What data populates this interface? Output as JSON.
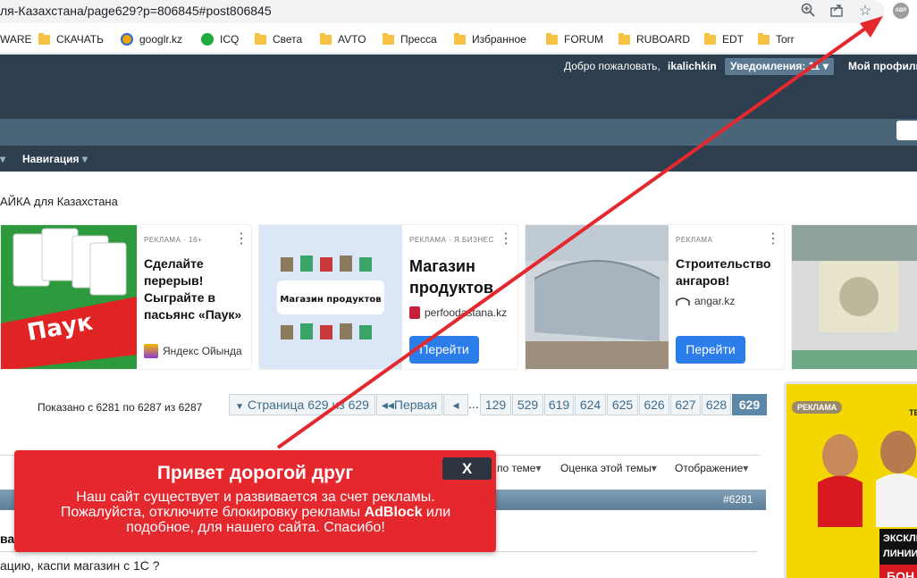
{
  "browser": {
    "url": "ля-Казахстана/page629?p=806845#post806845",
    "abp_label": "ABP",
    "bookmarks": [
      "WARE",
      "СКАЧАТЬ",
      "googlr.kz",
      "ICQ",
      "Света",
      "AVTO",
      "Пресса",
      "Избранное",
      "FORUM",
      "RUBOARD",
      "EDT",
      "Torr"
    ]
  },
  "header": {
    "welcome": "Добро пожаловать,",
    "username": "ikalichkin",
    "notifications": "Уведомления: 11",
    "profile": "Мой профиль"
  },
  "nav": {
    "navigation": "Навигация",
    "breadcrumb": "АЙКА для Казахстана"
  },
  "ads": [
    {
      "label": "РЕКЛАМА · 16+",
      "title": "Сделайте перерыв! Сыграйте в пасьянс «Паук»",
      "source": "Яндекс Ойында",
      "image_text": "Паук"
    },
    {
      "label": "РЕКЛАМА · Я.БИЗНЕС",
      "title": "Магазин продуктов",
      "source": "perfoodastana.kz",
      "image_text": "Магазин продуктов",
      "button": "Перейти"
    },
    {
      "label": "РЕКЛАМА",
      "title": "Строительство ангаров!",
      "source": "angar.kz",
      "button": "Перейти"
    }
  ],
  "pagination": {
    "shown": "Показано с 6281 по 6287 из 6287",
    "page_of": "Страница 629 из 629",
    "first": "Первая",
    "dots": "...",
    "pages": [
      "129",
      "529",
      "619",
      "624",
      "625",
      "626",
      "627",
      "628",
      "629"
    ],
    "current": "629"
  },
  "side_ad": {
    "badge": "РЕКЛАМА",
    "brand": "TENN",
    "text1": "ЭКСКЛЮЗ",
    "text2": "ЛИНИИ Н",
    "text3": "БОН"
  },
  "thread": {
    "tools": [
      "по теме",
      "Оценка этой темы",
      "Отображение"
    ],
    "post_number": "#6281",
    "fragment_bold": "ва",
    "fragment_text": "ацию, каспи магазин с 1С ?"
  },
  "modal": {
    "title": "Привет дорогой друг",
    "close": "X",
    "text_1": "Наш сайт существует и развивается за счет рекламы. Пожалуйста, отключите блокировку рекламы",
    "text_bold": "AdBlock",
    "text_2": "или подобное, для нашего сайта. Спасибо!"
  },
  "colors": {
    "header_bg": "#2d3e4e",
    "modal_bg": "#e5282e",
    "arrow": "#e5282e",
    "button_blue": "#2b7de9"
  }
}
